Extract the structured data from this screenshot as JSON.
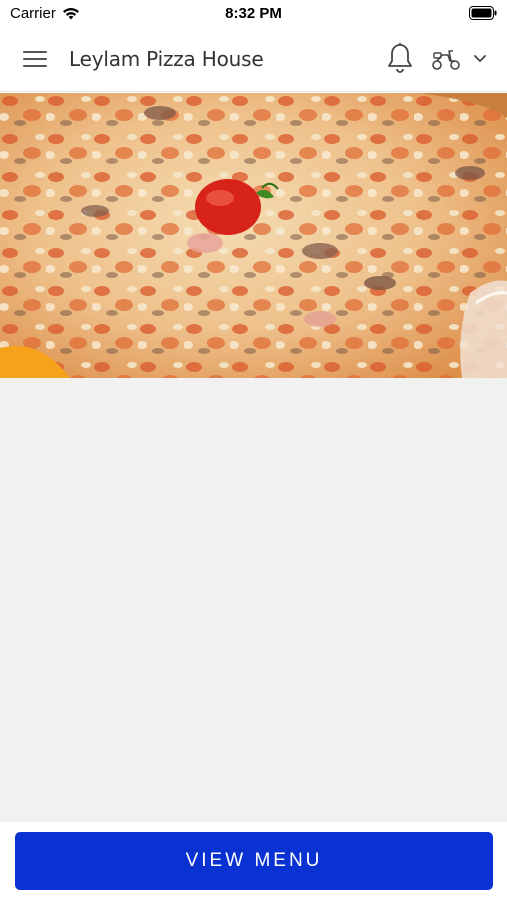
{
  "status_bar": {
    "carrier": "Carrier",
    "time": "8:32 PM"
  },
  "header": {
    "title": "Leylam Pizza House",
    "icons": [
      "menu-icon",
      "bell-icon",
      "scooter-icon",
      "chevron-down-icon"
    ]
  },
  "hero": {
    "image": "pizza-image"
  },
  "footer": {
    "view_menu_label": "VIEW MENU"
  },
  "colors": {
    "primary_button": "#0a32d2",
    "content_background": "#f1f1f2"
  }
}
